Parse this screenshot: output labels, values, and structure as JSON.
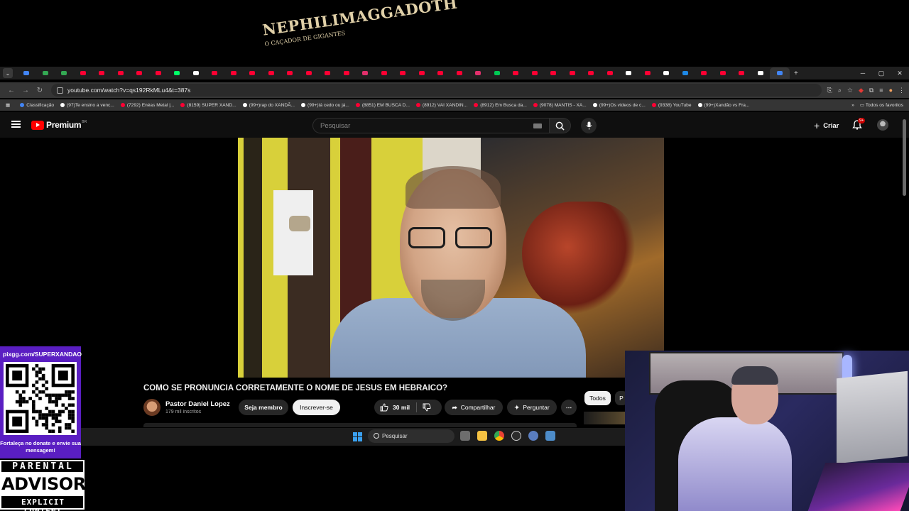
{
  "browser": {
    "url": "youtube.com/watch?v=qs192RkMLu4&t=387s",
    "tab_favicons": [
      "#4285f4",
      "#34a853",
      "#34a853",
      "#ff0033",
      "#ff0033",
      "#ff0033",
      "#ff0033",
      "#ff0033",
      "#00ff66",
      "#ffffff",
      "#ff0033",
      "#ff0033",
      "#ff0033",
      "#ff0033",
      "#ff0033",
      "#ff0033",
      "#ff0033",
      "#ff0033",
      "#e1306c",
      "#ff0033",
      "#ff0033",
      "#ff0033",
      "#ff0033",
      "#ff0033",
      "#e1306c",
      "#00c853",
      "#ff0033",
      "#ff0033",
      "#ff0033",
      "#ff0033",
      "#ff0033",
      "#ff0033",
      "#ffffff",
      "#ff0033",
      "#ffffff",
      "#1e88e5",
      "#ff0033",
      "#ff0033",
      "#ff0033",
      "#ffffff",
      "#4285f4"
    ],
    "bookmarks": [
      {
        "label": "Classificação",
        "color": "#4285f4"
      },
      {
        "label": "(97)Te ensino a venc...",
        "color": "#ffffff"
      },
      {
        "label": "(7292) Enéas Metal |...",
        "color": "#ff0033"
      },
      {
        "label": "(8159) SUPER XAND...",
        "color": "#ff0033"
      },
      {
        "label": "(99+)rap do XANDÃ...",
        "color": "#ffffff"
      },
      {
        "label": "(99+)tá cedo ou já...",
        "color": "#ffffff"
      },
      {
        "label": "(8851) EM BUSCA D...",
        "color": "#ff0033"
      },
      {
        "label": "(8912) VAI XANDIN...",
        "color": "#ff0033"
      },
      {
        "label": "(8912) Em Busca da...",
        "color": "#ff0033"
      },
      {
        "label": "(9078) MANTIS - XA...",
        "color": "#ff0033"
      },
      {
        "label": "(99+)Os vídeos de c...",
        "color": "#ffffff"
      },
      {
        "label": "(9338) YouTube",
        "color": "#ff0033"
      },
      {
        "label": "(99+)Xandão vs Fra...",
        "color": "#ffffff"
      }
    ],
    "all_bookmarks": "Todos os favoritos"
  },
  "youtube": {
    "logo_text": "Premium",
    "country_code": "BR",
    "search_placeholder": "Pesquisar",
    "create_label": "Criar",
    "notif_badge": "9+",
    "video_title": "COMO SE PRONUNCIA CORRETAMENTE O NOME DE JESUS EM HEBRAICO?",
    "channel_name": "Pastor Daniel Lopez",
    "subscribers": "179 mil inscritos",
    "member_label": "Seja membro",
    "subscribe_label": "Inscrever-se",
    "likes": "30 mil",
    "share_label": "Compartilhar",
    "ask_label": "Perguntar",
    "chip_all": "Todos",
    "chip_next": "P"
  },
  "video_frame": {
    "poster_title": "NEPHILIMAGGADOTH",
    "poster_subtitle": "O CAÇADOR DE GIGANTES"
  },
  "taskbar": {
    "search_label": "Pesquisar"
  },
  "overlay": {
    "donate_url": "pixgg.com/SUPERXANDAO",
    "donate_message": "Fortaleça no donate e envie sua mensagem!",
    "advisory_top": "PARENTAL",
    "advisory_mid": "ADVISORY",
    "advisory_bot": "EXPLICIT CONTENT"
  }
}
